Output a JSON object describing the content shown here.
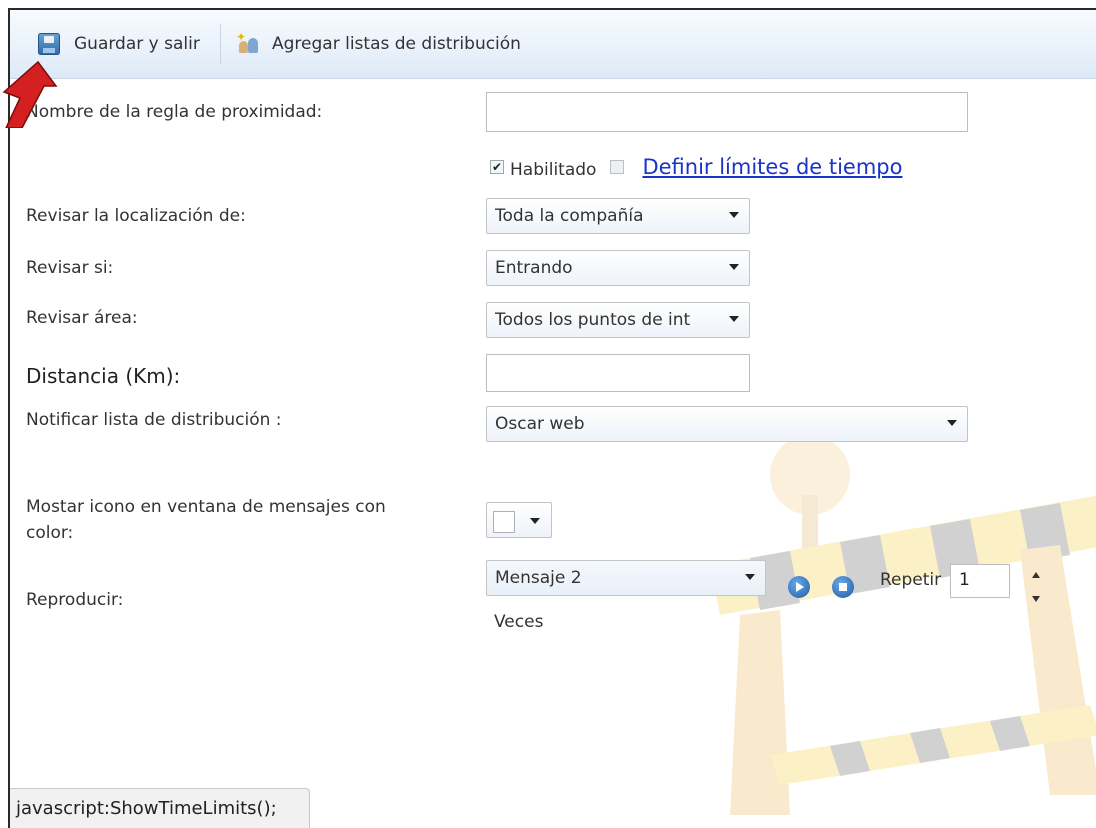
{
  "toolbar": {
    "save_label": "Guardar y salir",
    "add_lists_label": "Agregar listas de distribución"
  },
  "form": {
    "rule_name_label": "Nombre de la regla de proximidad:",
    "rule_name_value": "",
    "enabled_label": "Habilitado",
    "enabled_checked": true,
    "time_limits_checked": false,
    "time_limits_link": "Definir límites de tiempo",
    "check_location_label": "Revisar la localización de:",
    "check_location_value": "Toda la compañía",
    "check_if_label": "Revisar si:",
    "check_if_value": "Entrando",
    "check_area_label": "Revisar área:",
    "check_area_value": "Todos los puntos de int",
    "distance_label": "Distancia (Km):",
    "distance_value": "",
    "notify_list_label": "Notificar lista de distribución :",
    "notify_list_value": "Oscar web",
    "show_icon_label_line1": "Mostar icono en ventana de mensajes con",
    "show_icon_label_line2": "color:",
    "play_label": "Reproducir:",
    "play_value": "Mensaje 2",
    "repeat_label": "Repetir",
    "repeat_value": "1",
    "times_label": "Veces"
  },
  "status_bar": {
    "text": "javascript:ShowTimeLimits();"
  },
  "colors": {
    "link": "#1a33c8",
    "toolbar_bg": "#eaf2fb",
    "annotation_arrow": "#d42020"
  }
}
